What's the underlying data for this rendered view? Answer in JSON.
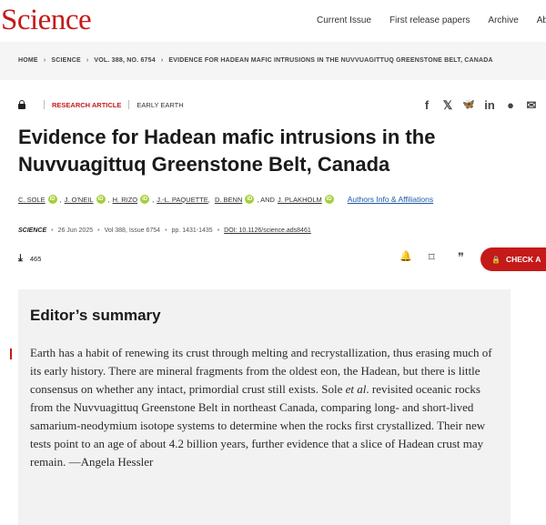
{
  "header": {
    "logo": "Science",
    "nav": [
      "Current Issue",
      "First release papers",
      "Archive",
      "Abo"
    ]
  },
  "breadcrumb": [
    "HOME",
    "SCIENCE",
    "VOL. 388, NO. 6754",
    "EVIDENCE FOR HADEAN MAFIC INTRUSIONS IN THE NUVVUAGITTUQ GREENSTONE BELT, CANADA"
  ],
  "article": {
    "type": "RESEARCH ARTICLE",
    "topic": "EARLY EARTH",
    "title_line1": "Evidence for Hadean mafic intrusions in the",
    "title_line2": "Nuvvuagittuq Greenstone Belt, Canada",
    "authors": [
      "C. SOLE",
      "J. O'NEIL",
      "H. RIZO",
      "J.-L. PAQUETTE",
      "D. BENN",
      "J. PLAKHOLM"
    ],
    "authors_and": ", AND",
    "orcid_mark": "iD",
    "affiliations_link": "Authors Info & Affiliations",
    "citation": {
      "journal": "SCIENCE",
      "date": "26 Jun 2025",
      "volume": "Vol 388, Issue 6754",
      "pages": "pp. 1431-1435",
      "doi": "DOI: 10.1126/science.ads8461"
    },
    "downloads": "465",
    "check_access": "CHECK A"
  },
  "share_icons": [
    "facebook-icon",
    "x-icon",
    "bluesky-icon",
    "linkedin-icon",
    "reddit-icon",
    "wechat-icon"
  ],
  "share_glyphs": [
    "f",
    "𝕏",
    "🦋",
    "in",
    "●",
    "✉"
  ],
  "action_glyphs": {
    "download": "⤓",
    "bell": "🔔",
    "bookmark": "⌑",
    "quote": "❞",
    "lock": "🔒"
  },
  "editor_summary": {
    "heading": "Editor’s summary",
    "text_before_italic": "Earth has a habit of renewing its crust through melting and recrystallization, thus erasing much of its early history. There are mineral fragments from the oldest eon, the Hadean, but there is little consensus on whether any intact, primordial crust still exists. Sole ",
    "italic": "et al",
    "text_after_italic": ". revisited oceanic rocks from the Nuvvuagittuq Greenstone Belt in northeast Canada, comparing long- and short-lived samarium-neodymium isotope systems to determine when the rocks first crystallized. Their new tests point to an age of about 4.2 billion years, further evidence that a slice of Hadean crust may remain. —Angela Hessler"
  },
  "colors": {
    "brand": "#c51a1a",
    "orcid": "#a6ce39",
    "link": "#1c5aa6"
  }
}
